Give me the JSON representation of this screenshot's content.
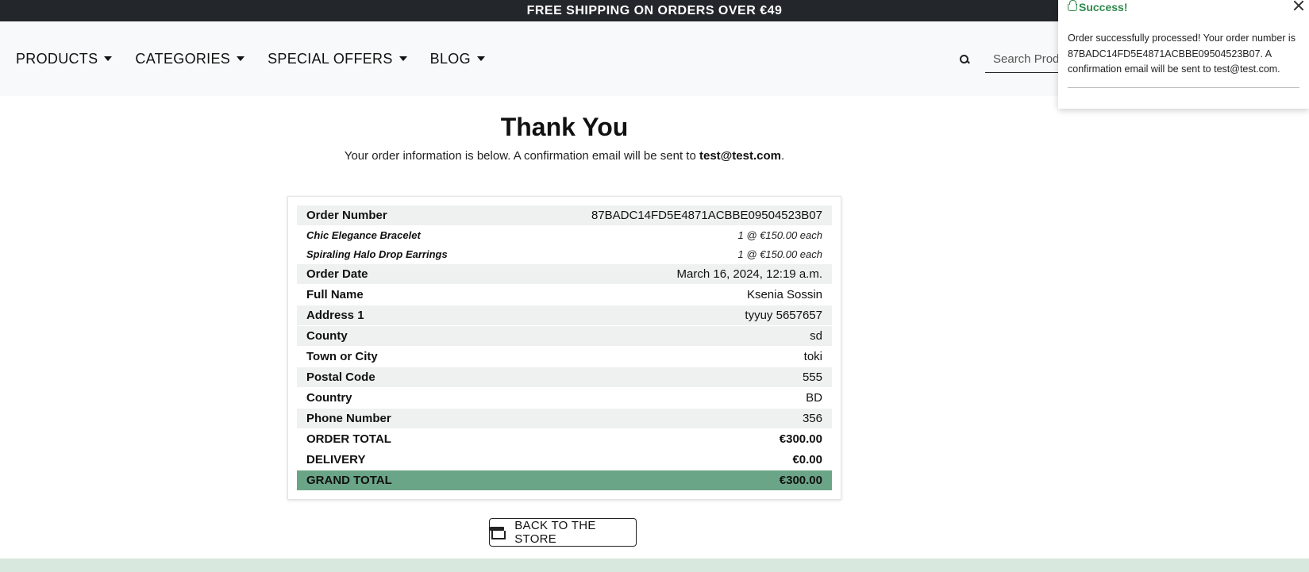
{
  "announcement": "FREE SHIPPING ON ORDERS OVER €49",
  "nav": {
    "items": [
      {
        "label": "PRODUCTS"
      },
      {
        "label": "CATEGORIES"
      },
      {
        "label": "SPECIAL OFFERS"
      },
      {
        "label": "BLOG"
      }
    ],
    "search_placeholder": "Search Products"
  },
  "page": {
    "title": "Thank You",
    "subtitle_prefix": "Your order information is below. A confirmation email will be sent to ",
    "email": "test@test.com",
    "subtitle_suffix": "."
  },
  "order": {
    "number_label": "Order Number",
    "number": "87BADC14FD5E4871ACBBE09504523B07",
    "items": [
      {
        "name": "Chic Elegance Bracelet",
        "qty_price": "1 @ €150.00 each"
      },
      {
        "name": "Spiraling Halo Drop Earrings",
        "qty_price": "1 @ €150.00 each"
      }
    ],
    "fields": [
      {
        "label": "Order Date",
        "value": "March 16, 2024, 12:19 a.m."
      },
      {
        "label": "Full Name",
        "value": "Ksenia Sossin"
      },
      {
        "label": "Address 1",
        "value": "tyyuy 5657657"
      },
      {
        "label": "County",
        "value": "sd"
      },
      {
        "label": "Town or City",
        "value": "toki"
      },
      {
        "label": "Postal Code",
        "value": "555"
      },
      {
        "label": "Country",
        "value": "BD"
      },
      {
        "label": "Phone Number",
        "value": "356"
      }
    ],
    "order_total_label": "ORDER TOTAL",
    "order_total": "€300.00",
    "delivery_label": "DELIVERY",
    "delivery": "€0.00",
    "grand_total_label": "GRAND TOTAL",
    "grand_total": "€300.00"
  },
  "back_button": "BACK TO THE STORE",
  "toast": {
    "title": "Success!",
    "message": "Order successfully processed! Your order number is 87BADC14FD5E4871ACBBE09504523B07. A confirmation email will be sent to test@test.com."
  },
  "colors": {
    "accent_green": "#6ba587",
    "success_text": "#2f8a4c",
    "topbar": "#23262b"
  }
}
